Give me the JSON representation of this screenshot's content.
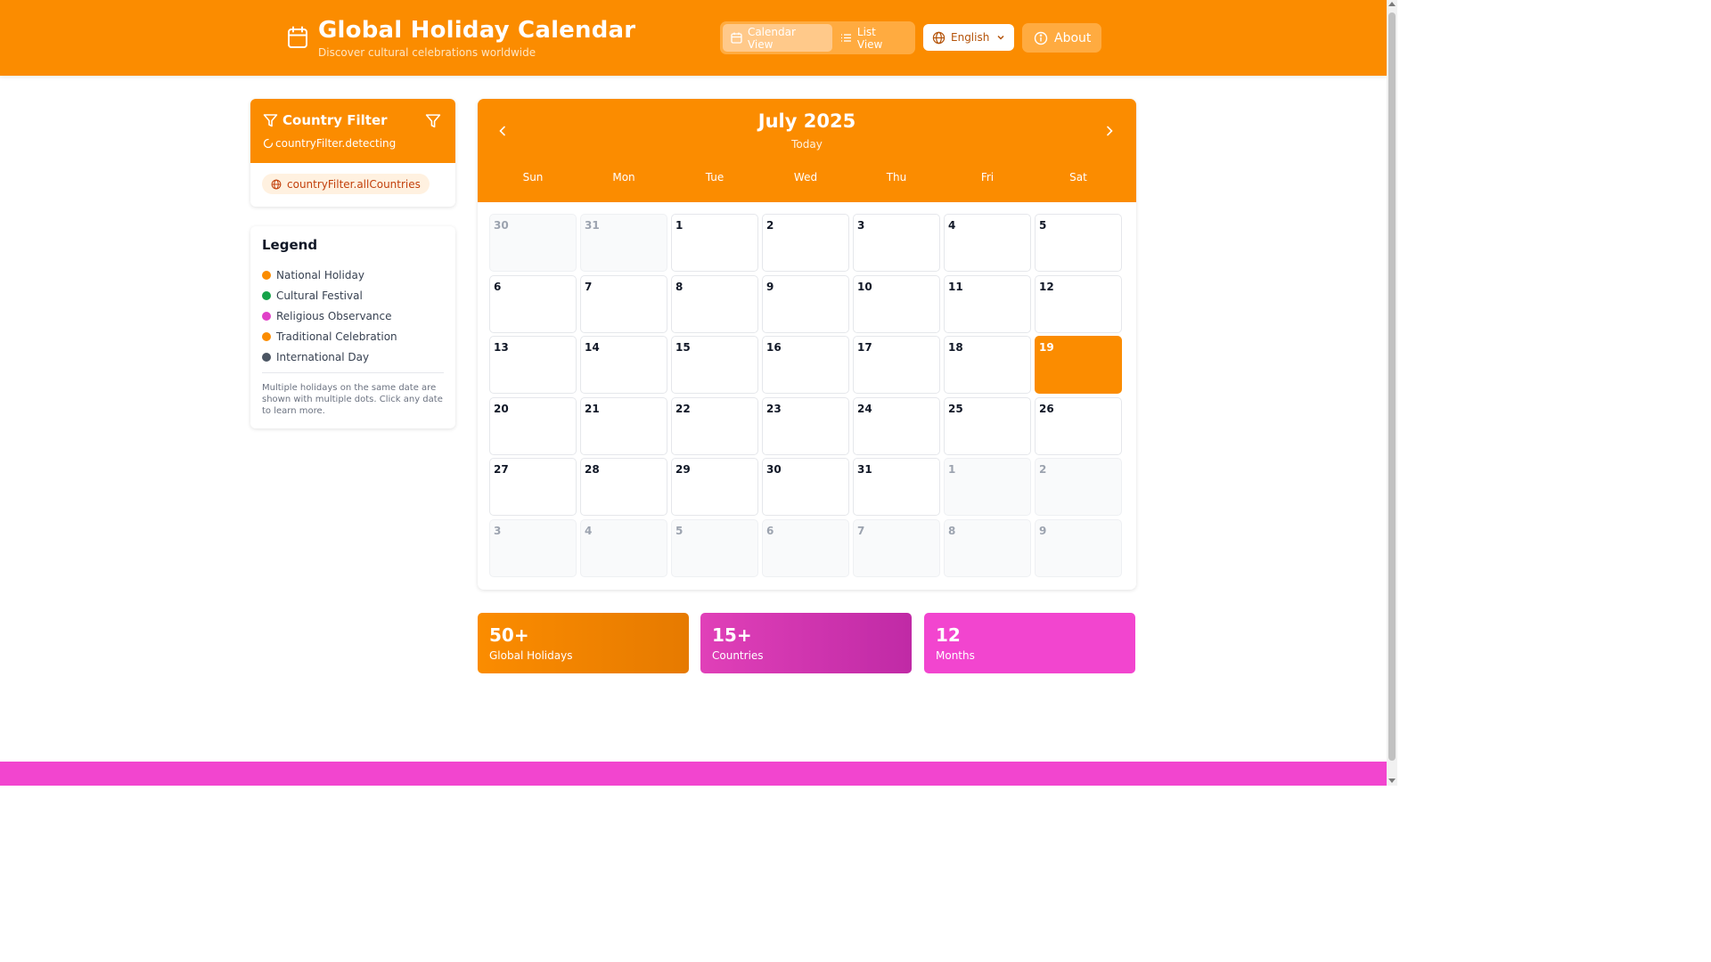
{
  "header": {
    "title": "Global Holiday Calendar",
    "subtitle": "Discover cultural celebrations worldwide",
    "calendar_view_label": "Calendar View",
    "list_view_label": "List View",
    "active_view": "calendar",
    "language_label": "English",
    "about_label": "About"
  },
  "country_filter": {
    "title": "Country Filter",
    "status": "countryFilter.detecting",
    "chip_label": "countryFilter.allCountries"
  },
  "legend": {
    "title": "Legend",
    "items": [
      {
        "label": "National Holiday",
        "color": "#fb8c00"
      },
      {
        "label": "Cultural Festival",
        "color": "#16a34a"
      },
      {
        "label": "Religious Observance",
        "color": "#e040c8"
      },
      {
        "label": "Traditional Celebration",
        "color": "#fb8c00"
      },
      {
        "label": "International Day",
        "color": "#4b5563"
      }
    ],
    "note": "Multiple holidays on the same date are shown with multiple dots. Click any date to learn more."
  },
  "calendar": {
    "month_title": "July 2025",
    "today_label": "Today",
    "weekdays": [
      "Sun",
      "Mon",
      "Tue",
      "Wed",
      "Thu",
      "Fri",
      "Sat"
    ],
    "days": [
      {
        "day": "30",
        "type": "outside"
      },
      {
        "day": "31",
        "type": "outside"
      },
      {
        "day": "1",
        "type": "current"
      },
      {
        "day": "2",
        "type": "current"
      },
      {
        "day": "3",
        "type": "current"
      },
      {
        "day": "4",
        "type": "current"
      },
      {
        "day": "5",
        "type": "current"
      },
      {
        "day": "6",
        "type": "current"
      },
      {
        "day": "7",
        "type": "current"
      },
      {
        "day": "8",
        "type": "current"
      },
      {
        "day": "9",
        "type": "current"
      },
      {
        "day": "10",
        "type": "current"
      },
      {
        "day": "11",
        "type": "current"
      },
      {
        "day": "12",
        "type": "current"
      },
      {
        "day": "13",
        "type": "current"
      },
      {
        "day": "14",
        "type": "current"
      },
      {
        "day": "15",
        "type": "current"
      },
      {
        "day": "16",
        "type": "current"
      },
      {
        "day": "17",
        "type": "current"
      },
      {
        "day": "18",
        "type": "current"
      },
      {
        "day": "19",
        "type": "today"
      },
      {
        "day": "20",
        "type": "current"
      },
      {
        "day": "21",
        "type": "current"
      },
      {
        "day": "22",
        "type": "current"
      },
      {
        "day": "23",
        "type": "current"
      },
      {
        "day": "24",
        "type": "current"
      },
      {
        "day": "25",
        "type": "current"
      },
      {
        "day": "26",
        "type": "current"
      },
      {
        "day": "27",
        "type": "current"
      },
      {
        "day": "28",
        "type": "current"
      },
      {
        "day": "29",
        "type": "current"
      },
      {
        "day": "30",
        "type": "current"
      },
      {
        "day": "31",
        "type": "current"
      },
      {
        "day": "1",
        "type": "outside"
      },
      {
        "day": "2",
        "type": "outside"
      },
      {
        "day": "3",
        "type": "outside"
      },
      {
        "day": "4",
        "type": "outside"
      },
      {
        "day": "5",
        "type": "outside"
      },
      {
        "day": "6",
        "type": "outside"
      },
      {
        "day": "7",
        "type": "outside"
      },
      {
        "day": "8",
        "type": "outside"
      },
      {
        "day": "9",
        "type": "outside"
      }
    ]
  },
  "stats": [
    {
      "value": "50+",
      "label": "Global Holidays"
    },
    {
      "value": "15+",
      "label": "Countries"
    },
    {
      "value": "12",
      "label": "Months"
    }
  ],
  "colors": {
    "accent_orange": "#fb8c00",
    "accent_pink": "#f245cf",
    "accent_magenta": "#c02aa6"
  }
}
